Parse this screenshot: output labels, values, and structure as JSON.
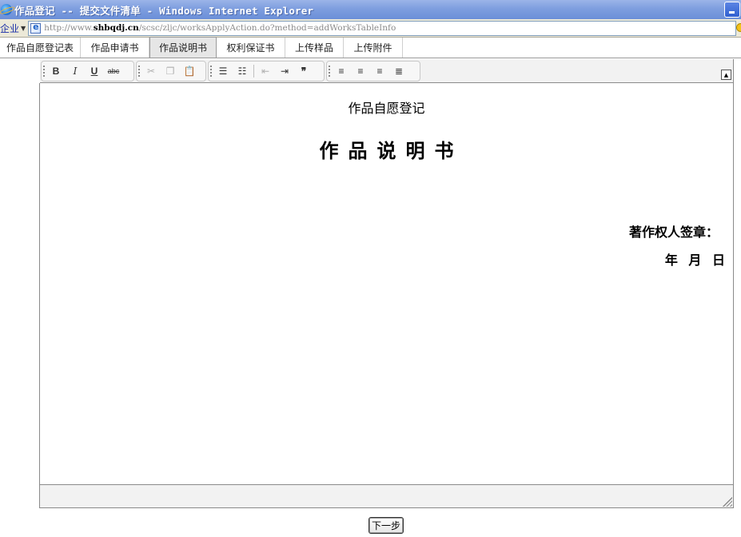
{
  "window": {
    "title": "作品登记 -- 提交文件清单 - Windows Internet Explorer"
  },
  "address": {
    "label": "企业",
    "url_prefix": "http://www.",
    "url_domain": "shbqdj.cn",
    "url_path": "/scsc/zljc/worksApplyAction.do?method=addWorksTableInfo"
  },
  "tabs": [
    {
      "label": "作品自愿登记表"
    },
    {
      "label": "作品申请书"
    },
    {
      "label": "作品说明书"
    },
    {
      "label": "权利保证书"
    },
    {
      "label": "上传样品"
    },
    {
      "label": "上传附件"
    }
  ],
  "toolbar": {
    "bold": "B",
    "italic": "I",
    "underline": "U",
    "strike": "abc",
    "quote": "❞"
  },
  "document": {
    "subtitle": "作品自愿登记",
    "title": "作品说明书",
    "signature_label": "著作权人签章：",
    "date_label": "年 月 日"
  },
  "footer": {
    "next_label": "下一步"
  }
}
